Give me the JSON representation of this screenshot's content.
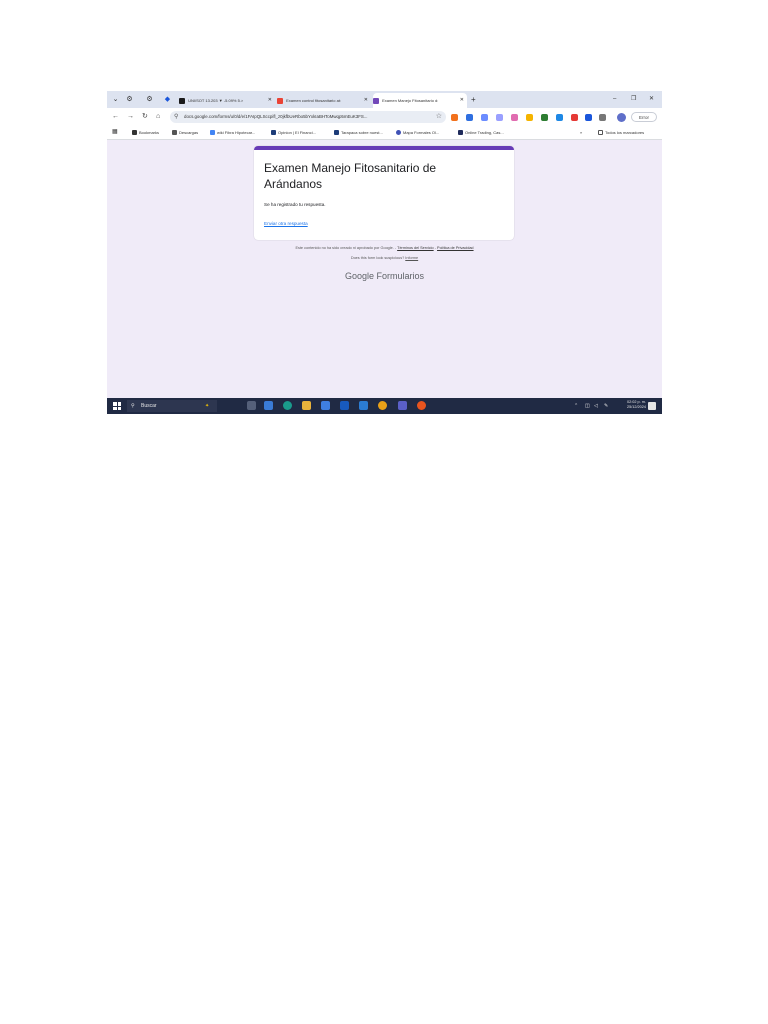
{
  "browser": {
    "tabs": [
      {
        "label": "UNI/SOT 13.203 ▼ -5.09% 5.>",
        "favicon_color": "#1a1a1a"
      },
      {
        "label": "Examen control fitosanitario at:",
        "favicon_color": "#ea4335"
      },
      {
        "label": "Examen Manejo Fitosanitario d:",
        "favicon_color": "#7248b9",
        "active": true
      }
    ],
    "url": "docs.google.com/forms/u/0/d/e/1FAIpQLSccpifl_z0jkfbUeRbo5bYxkIaBHToMwqp5mEuK3FS...",
    "profile_pill": "Error",
    "bookmarks": [
      "Bookmarks",
      "Descargas",
      "wiki Fibra Hipotecar...",
      "Opinion | El Financi...",
      "Tarapaca sobre nuest...",
      "Mapa Formales Ol...",
      "Online Trading, Cas..."
    ],
    "bookmarks_overflow": "»",
    "all_bookmarks": "Todos los marcadores"
  },
  "form": {
    "title": "Examen Manejo Fitosanitario de Arándanos",
    "response_text": "Se ha registrado tu respuesta.",
    "another_link": "Enviar otra respuesta",
    "accent_color": "#673ab7"
  },
  "footer": {
    "disclaimer": "Este contenido no ha sido creado ni aprobado por Google. -",
    "terms": "Términos del Servicio",
    "sep": "-",
    "privacy": "Política de Privacidad",
    "suspicious": "Does this form look suspicious?",
    "report": "Informe",
    "brand_google": "Google",
    "brand_forms": "Formularios"
  },
  "taskbar": {
    "search_placeholder": "Buscar",
    "time": "02:02 p. m.",
    "date": "25/12/2024"
  }
}
